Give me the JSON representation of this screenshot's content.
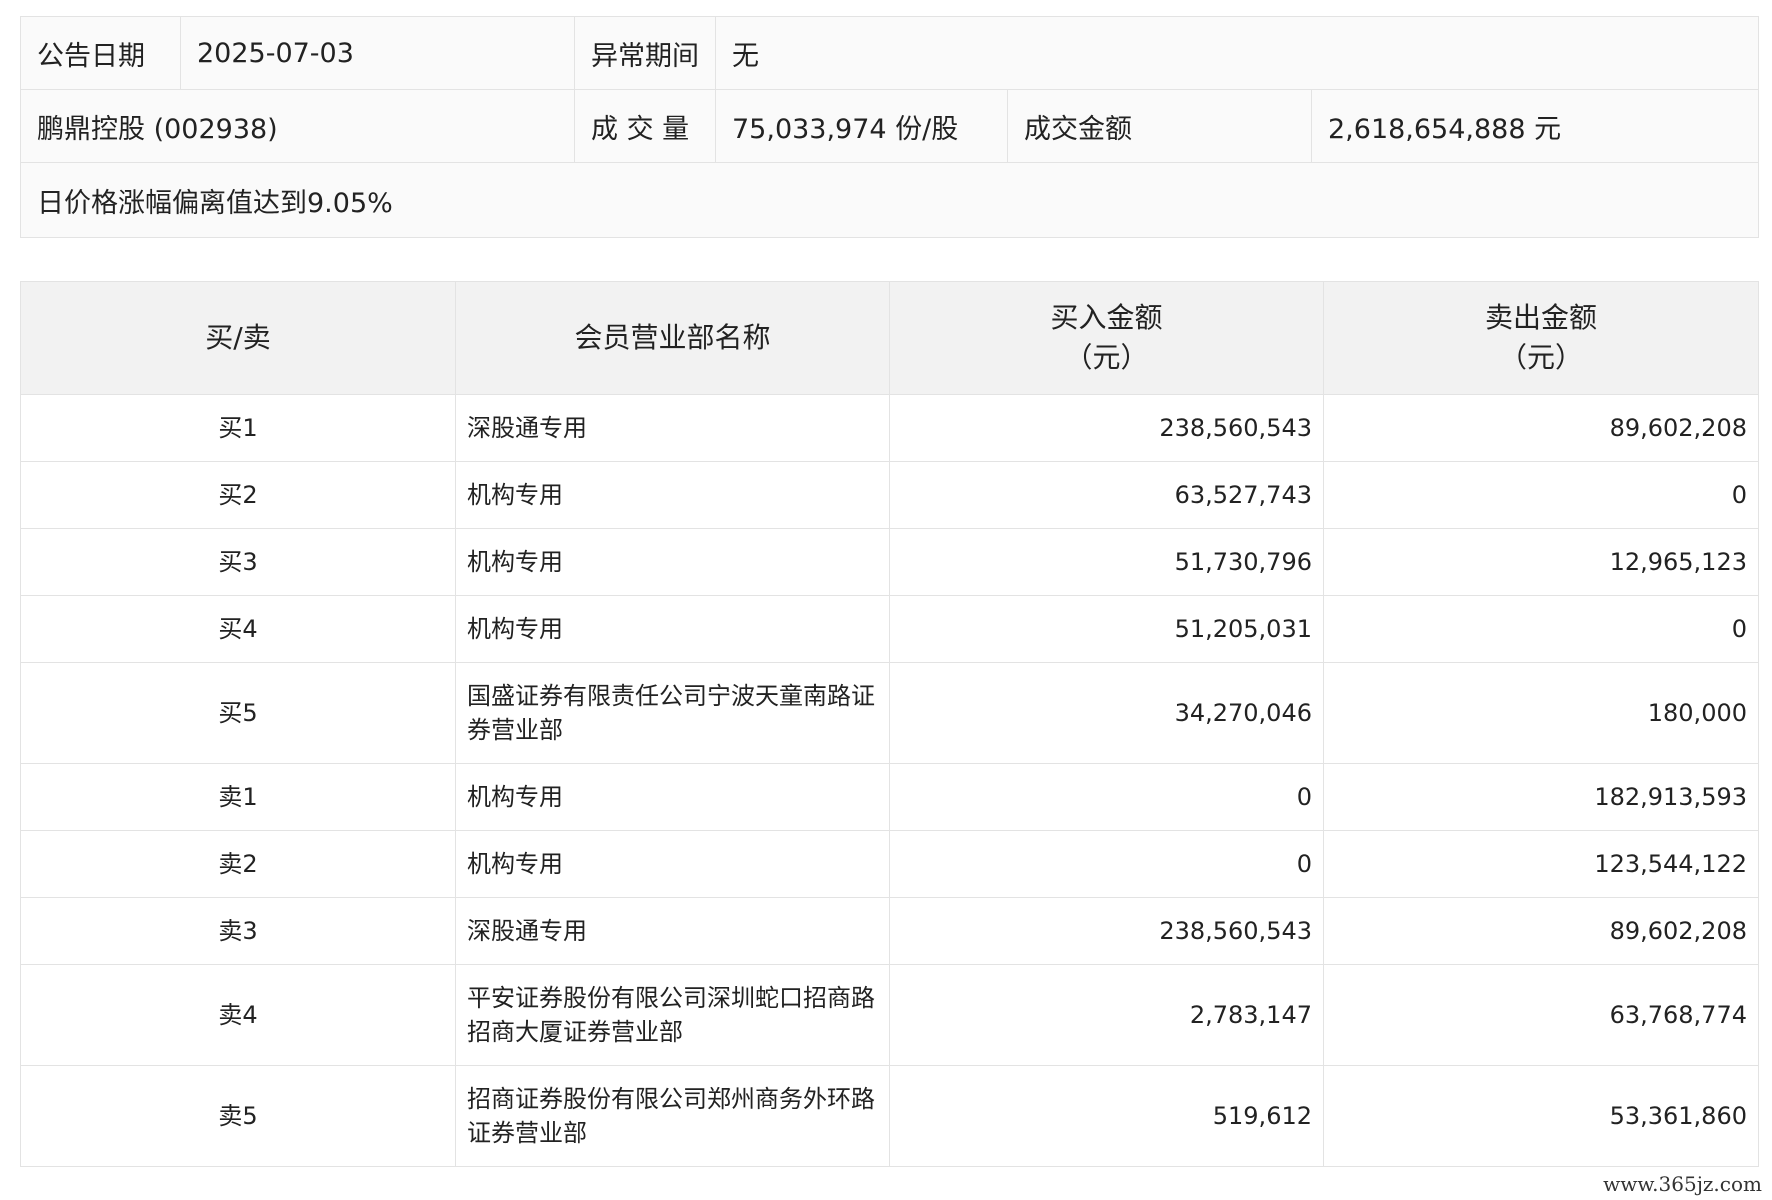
{
  "info": {
    "announce_date_label": "公告日期",
    "announce_date": "2025-07-03",
    "abnormal_period_label": "异常期间",
    "abnormal_period": "无",
    "stock": "鹏鼎控股 (002938)",
    "volume_label": "成 交 量",
    "volume": "75,033,974 份/股",
    "amount_label": "成交金额",
    "amount": "2,618,654,888 元",
    "description": "日价格涨幅偏离值达到9.05%"
  },
  "table": {
    "headers": {
      "side": "买/卖",
      "member": "会员营业部名称",
      "buy_line1": "买入金额",
      "buy_line2": "（元）",
      "sell_line1": "卖出金额",
      "sell_line2": "（元）"
    },
    "rows": [
      {
        "side": "买1",
        "name": "深股通专用",
        "buy": "238,560,543",
        "sell": "89,602,208"
      },
      {
        "side": "买2",
        "name": "机构专用",
        "buy": "63,527,743",
        "sell": "0"
      },
      {
        "side": "买3",
        "name": "机构专用",
        "buy": "51,730,796",
        "sell": "12,965,123"
      },
      {
        "side": "买4",
        "name": "机构专用",
        "buy": "51,205,031",
        "sell": "0"
      },
      {
        "side": "买5",
        "name": "国盛证券有限责任公司宁波天童南路证券营业部",
        "buy": "34,270,046",
        "sell": "180,000"
      },
      {
        "side": "卖1",
        "name": "机构专用",
        "buy": "0",
        "sell": "182,913,593"
      },
      {
        "side": "卖2",
        "name": "机构专用",
        "buy": "0",
        "sell": "123,544,122"
      },
      {
        "side": "卖3",
        "name": "深股通专用",
        "buy": "238,560,543",
        "sell": "89,602,208"
      },
      {
        "side": "卖4",
        "name": "平安证券股份有限公司深圳蛇口招商路招商大厦证券营业部",
        "buy": "2,783,147",
        "sell": "63,768,774"
      },
      {
        "side": "卖5",
        "name": "招商证券股份有限公司郑州商务外环路证券营业部",
        "buy": "519,612",
        "sell": "53,361,860"
      }
    ]
  },
  "watermark": "www.365jz.com"
}
